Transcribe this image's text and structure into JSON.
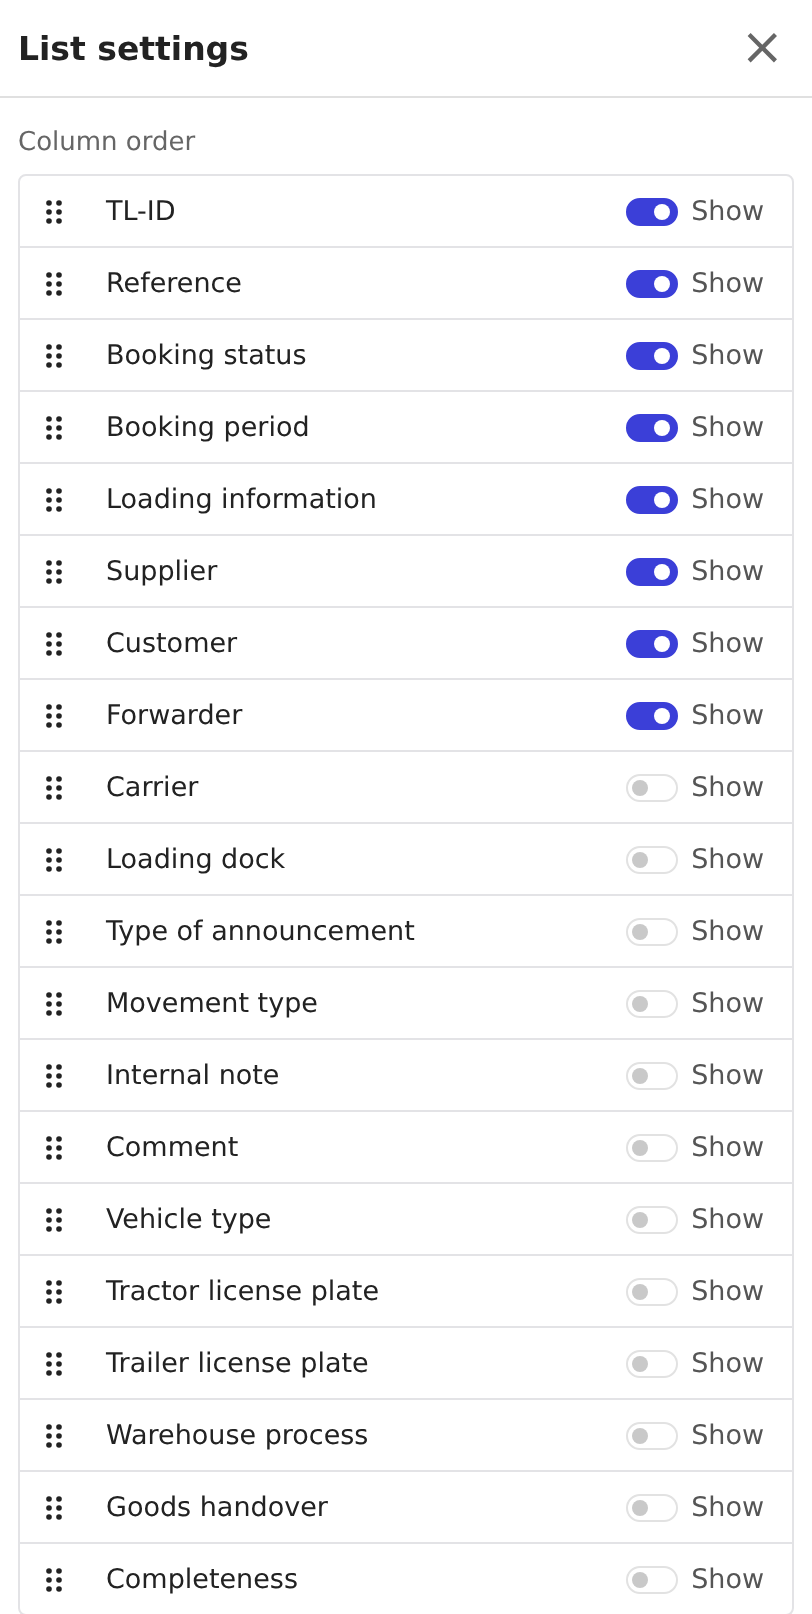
{
  "header": {
    "title": "List settings",
    "close": "×"
  },
  "section_label": "Column order",
  "columns": [
    {
      "name": "TL-ID",
      "on": true,
      "label": "Show"
    },
    {
      "name": "Reference",
      "on": true,
      "label": "Show"
    },
    {
      "name": "Booking status",
      "on": true,
      "label": "Show"
    },
    {
      "name": "Booking period",
      "on": true,
      "label": "Show"
    },
    {
      "name": "Loading information",
      "on": true,
      "label": "Show"
    },
    {
      "name": "Supplier",
      "on": true,
      "label": "Show"
    },
    {
      "name": "Customer",
      "on": true,
      "label": "Show"
    },
    {
      "name": "Forwarder",
      "on": true,
      "label": "Show"
    },
    {
      "name": "Carrier",
      "on": false,
      "label": "Show"
    },
    {
      "name": "Loading dock",
      "on": false,
      "label": "Show"
    },
    {
      "name": "Type of announcement",
      "on": false,
      "label": "Show"
    },
    {
      "name": "Movement type",
      "on": false,
      "label": "Show"
    },
    {
      "name": "Internal note",
      "on": false,
      "label": "Show"
    },
    {
      "name": "Comment",
      "on": false,
      "label": "Show"
    },
    {
      "name": "Vehicle type",
      "on": false,
      "label": "Show"
    },
    {
      "name": "Tractor license plate",
      "on": false,
      "label": "Show"
    },
    {
      "name": "Trailer license plate",
      "on": false,
      "label": "Show"
    },
    {
      "name": "Warehouse process",
      "on": false,
      "label": "Show"
    },
    {
      "name": "Goods handover",
      "on": false,
      "label": "Show"
    },
    {
      "name": "Completeness",
      "on": false,
      "label": "Show"
    }
  ]
}
